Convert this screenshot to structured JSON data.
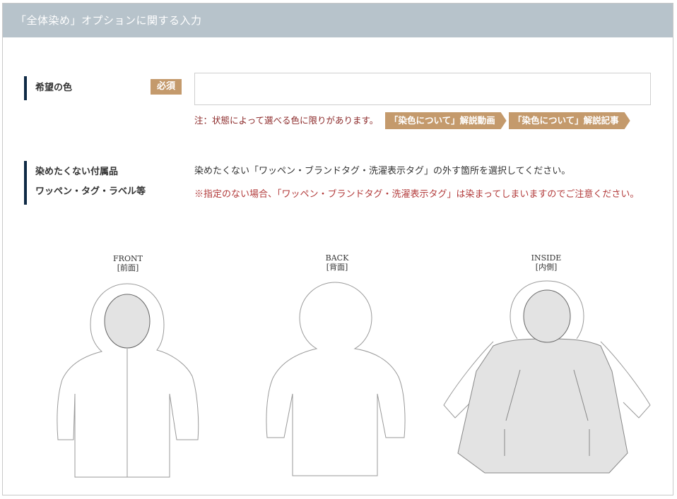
{
  "header": {
    "title": "「全体染め」オプションに関する入力"
  },
  "color_row": {
    "label": "希望の色",
    "required_badge": "必須",
    "input_value": "",
    "input_placeholder": "",
    "note": "注：状態によって選べる色に限りがあります。",
    "buttons": [
      "「染色について」解説動画",
      "「染色について」解説記事"
    ]
  },
  "accessory_row": {
    "label_line1": "染めたくない付属品",
    "label_line2": "ワッペン・タグ・ラベル等",
    "description": "染めたくない「ワッペン・ブランドタグ・洗濯表示タグ」の外す箇所を選択してください。",
    "warning": "※指定のない場合、「ワッペン・ブランドタグ・洗濯表示タグ」は染まってしまいますのでご注意ください。"
  },
  "views": [
    {
      "name": "FRONT",
      "sub": "[前面]"
    },
    {
      "name": "BACK",
      "sub": "[背面]"
    },
    {
      "name": "INSIDE",
      "sub": "[内側]"
    }
  ],
  "colors": {
    "header_bg": "#b7c3cb",
    "accent_bar": "#0f2a45",
    "badge": "#c49a6c",
    "note_text": "#8c2a2a",
    "warning_text": "#b23a3a",
    "selectable_fill": "#e3e3e3"
  }
}
